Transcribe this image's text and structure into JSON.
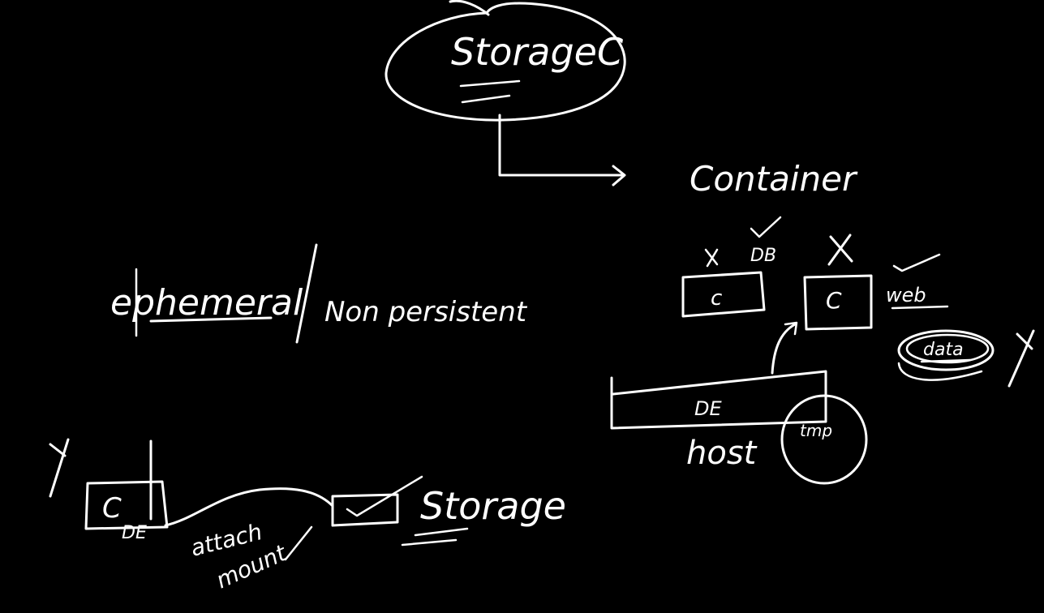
{
  "canvas": {
    "background": "#000000",
    "ink": "#ffffff"
  },
  "labels": {
    "storage_class": "StorageC",
    "container": "Container",
    "db": "DB",
    "c_left": "c",
    "c_right": "C",
    "web": "web",
    "data": "data",
    "x_mark": "X",
    "ephemeral": "ephemeral",
    "slash": "/",
    "non_persistent": "Non persistent",
    "de": "DE",
    "host": "host",
    "tmp": "tmp",
    "c_bottom": "C",
    "de_bottom": "DE",
    "attach": "attach",
    "mount": "mount",
    "storage": "Storage"
  }
}
